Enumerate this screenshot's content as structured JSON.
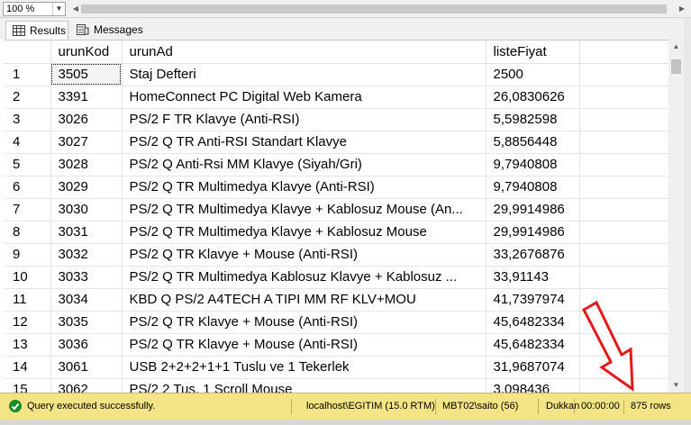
{
  "toolbar": {
    "zoom": "100 %"
  },
  "tabs": [
    {
      "label": "Results",
      "icon": "grid-icon",
      "active": true
    },
    {
      "label": "Messages",
      "icon": "messages-icon",
      "active": false
    }
  ],
  "columns": [
    "",
    "urunKod",
    "urunAd",
    "listeFiyat"
  ],
  "rows": [
    {
      "n": "1",
      "kod": "3505",
      "ad": "Staj Defteri",
      "fiyat": "2500"
    },
    {
      "n": "2",
      "kod": "3391",
      "ad": "HomeConnect PC Digital Web Kamera",
      "fiyat": "26,0830626"
    },
    {
      "n": "3",
      "kod": "3026",
      "ad": "PS/2 F TR Klavye (Anti-RSI)",
      "fiyat": "5,5982598"
    },
    {
      "n": "4",
      "kod": "3027",
      "ad": "PS/2 Q TR Anti-RSI Standart Klavye",
      "fiyat": "5,8856448"
    },
    {
      "n": "5",
      "kod": "3028",
      "ad": "PS/2 Q Anti-Rsi MM Klavye (Siyah/Gri)",
      "fiyat": "9,7940808"
    },
    {
      "n": "6",
      "kod": "3029",
      "ad": "PS/2 Q TR Multimedya Klavye (Anti-RSI)",
      "fiyat": "9,7940808"
    },
    {
      "n": "7",
      "kod": "3030",
      "ad": "PS/2 Q TR Multimedya Klavye + Kablosuz Mouse (An...",
      "fiyat": "29,9914986"
    },
    {
      "n": "8",
      "kod": "3031",
      "ad": "PS/2 Q TR Multimedya Klavye + Kablosuz Mouse",
      "fiyat": "29,9914986"
    },
    {
      "n": "9",
      "kod": "3032",
      "ad": "PS/2 Q TR Klavye + Mouse (Anti-RSI)",
      "fiyat": "33,2676876"
    },
    {
      "n": "10",
      "kod": "3033",
      "ad": "PS/2 Q TR Multimedya Kablosuz Klavye + Kablosuz ...",
      "fiyat": "33,91143"
    },
    {
      "n": "11",
      "kod": "3034",
      "ad": "KBD Q PS/2 A4TECH A TIPI MM RF KLV+MOU",
      "fiyat": "41,7397974"
    },
    {
      "n": "12",
      "kod": "3035",
      "ad": "PS/2 Q TR Klavye + Mouse (Anti-RSI)",
      "fiyat": "45,6482334"
    },
    {
      "n": "13",
      "kod": "3036",
      "ad": "PS/2 Q TR Klavye + Mouse (Anti-RSI)",
      "fiyat": "45,6482334"
    },
    {
      "n": "14",
      "kod": "3061",
      "ad": "USB 2+2+2+1+1 Tuslu ve 1 Tekerlek",
      "fiyat": "31,9687074"
    },
    {
      "n": "15",
      "kod": "3062",
      "ad": "PS/2 2 Tus, 1 Scroll Mouse",
      "fiyat": "3,098436"
    }
  ],
  "status": {
    "message": "Query executed successfully.",
    "server": "localhost\\EGITIM (15.0 RTM)",
    "user": "MBT02\\saito (56)",
    "database": "Dukkan",
    "elapsed": "00:00:00",
    "rowcount": "875 rows"
  },
  "colors": {
    "status_bg": "#f3e485",
    "arrow": "#e11b1b",
    "success": "#1b8a2a"
  }
}
